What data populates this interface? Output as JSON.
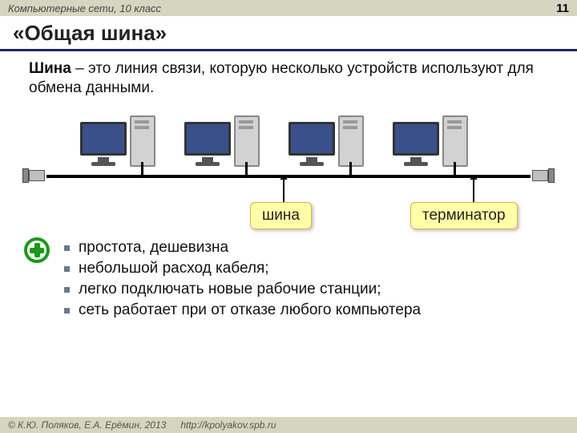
{
  "header": {
    "course": "Компьютерные сети, 10 класс",
    "page": "11"
  },
  "title": "«Общая шина»",
  "definition": {
    "term": "Шина",
    "rest": " – это линия связи, которую несколько устройств используют для обмена данными."
  },
  "labels": {
    "bus": "шина",
    "terminator": "терминатор"
  },
  "advantages": [
    "простота, дешевизна",
    "небольшой расход кабеля;",
    "легко подключать новые рабочие станции;",
    "сеть работает при от отказе любого компьютера"
  ],
  "footer": {
    "copyright": "© К.Ю. Поляков, Е.А. Ерёмин, 2013",
    "url": "http://kpolyakov.spb.ru"
  }
}
